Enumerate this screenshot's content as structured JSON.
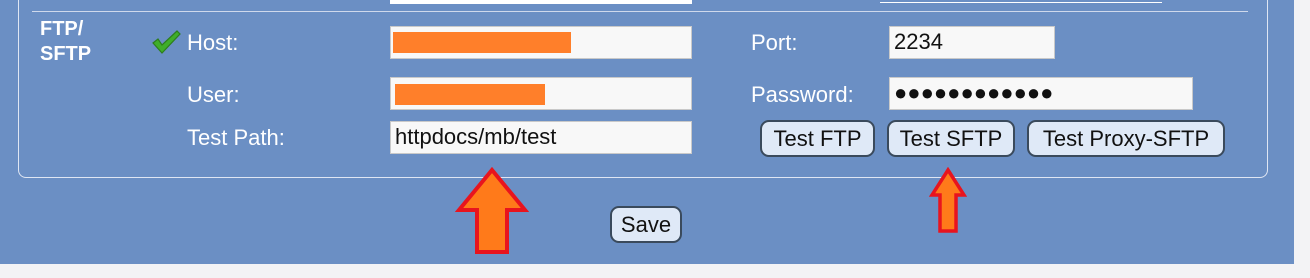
{
  "section": {
    "title": "FTP/\nSFTP",
    "status_icon": "green-check-icon"
  },
  "fields": {
    "host": {
      "label": "Host:",
      "value": ""
    },
    "user": {
      "label": "User:",
      "value": ""
    },
    "test_path": {
      "label": "Test Path:",
      "value": "httpdocs/mb/test"
    },
    "port": {
      "label": "Port:",
      "value": "2234"
    },
    "password": {
      "label": "Password:",
      "value": "●●●●●●●●●●●●"
    }
  },
  "buttons": {
    "test_ftp": "Test FTP",
    "test_sftp": "Test SFTP",
    "test_proxy_sftp": "Test Proxy-SFTP",
    "save": "Save"
  },
  "colors": {
    "panel_bg": "#6b8fc4",
    "redaction": "#ff7f2a",
    "arrow_fill": "#ff7a1a",
    "arrow_stroke": "#e8141e"
  },
  "annotations": [
    "arrow-up-icon",
    "arrow-up-icon"
  ]
}
